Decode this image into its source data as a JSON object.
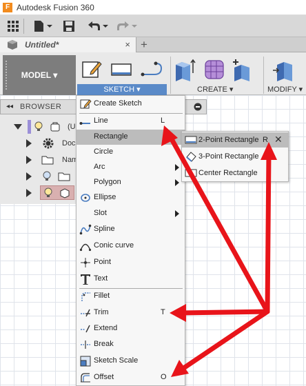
{
  "app": {
    "title": "Autodesk Fusion 360",
    "logo_letter": "F"
  },
  "document_tab": {
    "title": "Untitled*",
    "close_glyph": "×",
    "add_glyph": "+"
  },
  "workspace": {
    "label": "MODEL ▾"
  },
  "ribbon": {
    "sketch_label": "SKETCH ▾",
    "create_label": "CREATE ▾",
    "modify_label": "MODIFY ▾"
  },
  "browser": {
    "title": "BROWSER",
    "collapse_glyph": "◂◂",
    "items": [
      "(U",
      "Doc",
      "Nam"
    ]
  },
  "sketch_menu": {
    "items": [
      {
        "label": "Create Sketch",
        "shortcut": "",
        "submenu": false,
        "icon": "create-sketch-icon"
      },
      {
        "label": "Line",
        "shortcut": "L",
        "submenu": false,
        "icon": "line-icon"
      },
      {
        "label": "Rectangle",
        "shortcut": "",
        "submenu": false,
        "icon": ""
      },
      {
        "label": "Circle",
        "shortcut": "",
        "submenu": false,
        "icon": ""
      },
      {
        "label": "Arc",
        "shortcut": "",
        "submenu": true,
        "icon": ""
      },
      {
        "label": "Polygon",
        "shortcut": "",
        "submenu": true,
        "icon": ""
      },
      {
        "label": "Ellipse",
        "shortcut": "",
        "submenu": false,
        "icon": "ellipse-icon"
      },
      {
        "label": "Slot",
        "shortcut": "",
        "submenu": true,
        "icon": ""
      },
      {
        "label": "Spline",
        "shortcut": "",
        "submenu": false,
        "icon": "spline-icon"
      },
      {
        "label": "Conic curve",
        "shortcut": "",
        "submenu": false,
        "icon": "conic-curve-icon"
      },
      {
        "label": "Point",
        "shortcut": "",
        "submenu": false,
        "icon": "point-icon"
      },
      {
        "label": "Text",
        "shortcut": "",
        "submenu": false,
        "icon": "text-icon"
      },
      {
        "label": "Fillet",
        "shortcut": "",
        "submenu": false,
        "icon": "fillet-icon"
      },
      {
        "label": "Trim",
        "shortcut": "T",
        "submenu": false,
        "icon": "trim-icon"
      },
      {
        "label": "Extend",
        "shortcut": "",
        "submenu": false,
        "icon": "extend-icon"
      },
      {
        "label": "Break",
        "shortcut": "",
        "submenu": false,
        "icon": "break-icon"
      },
      {
        "label": "Sketch Scale",
        "shortcut": "",
        "submenu": false,
        "icon": "sketch-scale-icon"
      },
      {
        "label": "Offset",
        "shortcut": "O",
        "submenu": false,
        "icon": "offset-icon"
      }
    ]
  },
  "rectangle_submenu": {
    "items": [
      {
        "label": "2-Point Rectangle",
        "shortcut": "R",
        "pin_glyph": "✕",
        "icon": "two-point-rectangle-icon"
      },
      {
        "label": "3-Point Rectangle",
        "shortcut": "",
        "icon": "three-point-rectangle-icon"
      },
      {
        "label": "Center Rectangle",
        "shortcut": "",
        "icon": "center-rectangle-icon"
      }
    ]
  },
  "colors": {
    "accent": "#5a8ac8",
    "highlight": "#bcbcbc",
    "annotation_arrow": "#e8141a",
    "workspace_button": "#7d7d7d"
  }
}
